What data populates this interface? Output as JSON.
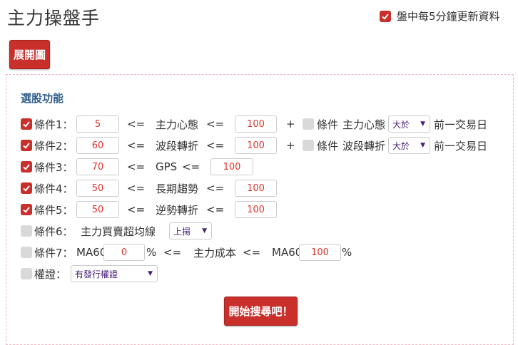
{
  "header": {
    "title": "主力操盤手",
    "auto_refresh": {
      "label": "盤中每5分鐘更新資料",
      "checked": true
    }
  },
  "expand_button": "展開圖",
  "filter": {
    "section_title": "選股功能",
    "op_le": "<=",
    "plus": "+",
    "percent": "%",
    "conditions": [
      {
        "checked": true,
        "label": "條件1：",
        "min": "5",
        "metric": "主力心態",
        "max": "100",
        "extra": {
          "checked": false,
          "label": "條件",
          "metric": "主力心態",
          "select": "大於",
          "suffix": "前一交易日"
        }
      },
      {
        "checked": true,
        "label": "條件2：",
        "min": "60",
        "metric": "波段轉折",
        "max": "100",
        "extra": {
          "checked": false,
          "label": "條件",
          "metric": "波段轉折",
          "select": "大於",
          "suffix": "前一交易日"
        }
      },
      {
        "checked": true,
        "label": "條件3：",
        "min": "70",
        "metric": "GPS",
        "max": "100"
      },
      {
        "checked": true,
        "label": "條件4：",
        "min": "50",
        "metric": "長期趨勢",
        "max": "100"
      },
      {
        "checked": true,
        "label": "條件5：",
        "min": "50",
        "metric": "逆勢轉折",
        "max": "100"
      },
      {
        "checked": false,
        "label": "條件6：",
        "metric": "主力買賣超均線",
        "select": "上揚"
      },
      {
        "checked": false,
        "label": "條件7：",
        "left_prefix": "MA60",
        "left_value": "0",
        "metric": "主力成本",
        "right_prefix": "MA60",
        "right_value": "100"
      }
    ],
    "warrant": {
      "checked": false,
      "label": "權證：",
      "select": "有發行權證"
    }
  },
  "start_button": "開始搜尋吧！",
  "colors": {
    "accent_red": "#c9302c",
    "section_blue": "#2e5c8a",
    "value_red": "#e0342f",
    "select_purple": "#4a1f7a",
    "panel_border": "#f1b8c4"
  }
}
